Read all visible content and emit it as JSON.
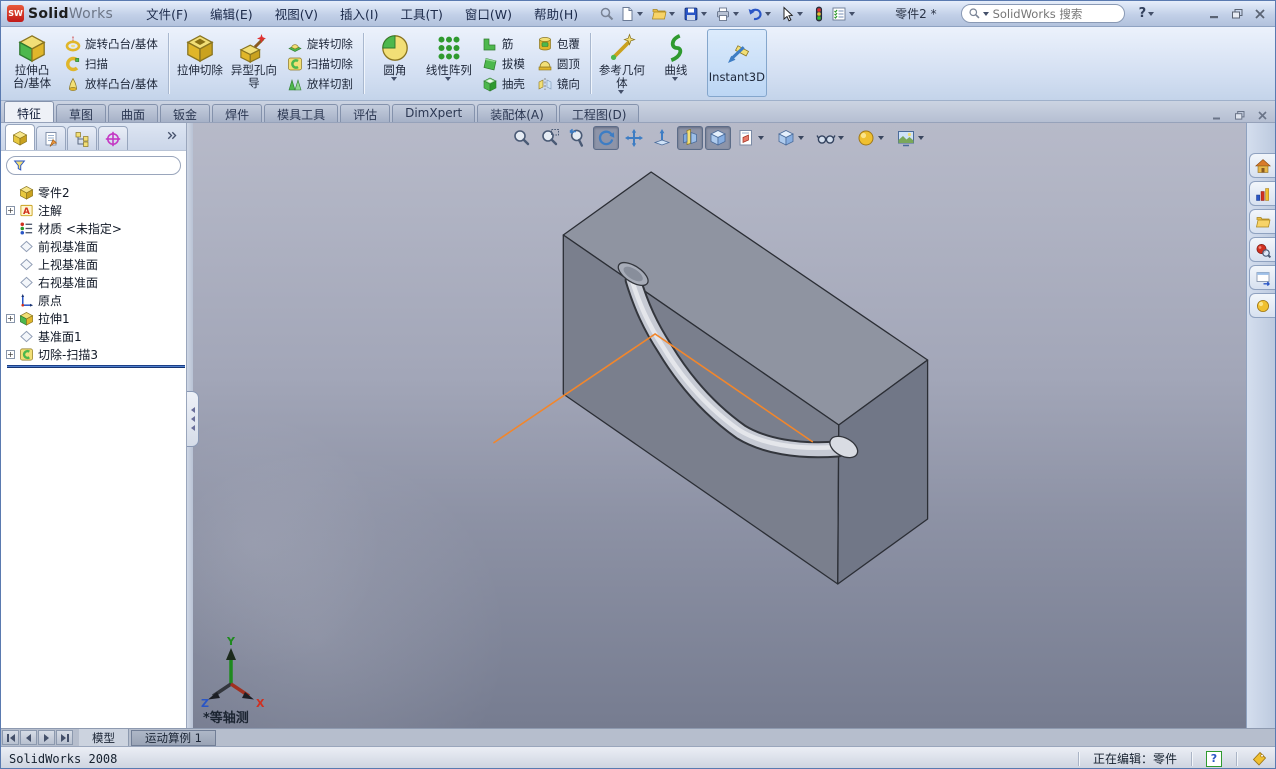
{
  "colors": {
    "brand_red": "#c01818",
    "selection_pressed": "#52607a",
    "sketch_orange": "#f2862b",
    "rollback_blue": "#2c5eb8",
    "viewport_top": "#b7bac9",
    "viewport_bottom": "#767c90",
    "model_front_face": "#7a7f8d",
    "model_top_face": "#8f94a1",
    "model_right_face": "#717787",
    "triad_x_red": "#d03020",
    "triad_y_green": "#1e8a1e",
    "triad_z_blue": "#2a56c6"
  },
  "titlebar": {
    "logo_sw": "SW",
    "logo_solid": "Solid",
    "logo_works": "Works",
    "menus": [
      "文件(F)",
      "编辑(E)",
      "视图(V)",
      "插入(I)",
      "工具(T)",
      "窗口(W)",
      "帮助(H)"
    ],
    "doc_title": "零件2 *",
    "search_placeholder": "SolidWorks 搜索",
    "help_label": "?"
  },
  "commandbar": {
    "extrude_boss": "拉伸凸台/基体",
    "revolve_boss": "旋转凸台/基体",
    "sweep": "扫描",
    "loft_boss": "放样凸台/基体",
    "extrude_cut": "拉伸切除",
    "hole_wizard": "异型孔向导",
    "revolve_cut": "旋转切除",
    "sweep_cut": "扫描切除",
    "loft_cut": "放样切割",
    "fillet": "圆角",
    "linear_pattern": "线性阵列",
    "rib": "筋",
    "draft": "拔模",
    "shell": "抽壳",
    "wrap": "包覆",
    "dome": "圆顶",
    "mirror": "镜向",
    "reference_geometry": "参考几何体",
    "curves": "曲线",
    "instant3d": "Instant3D"
  },
  "ribbon_tabs": {
    "items": [
      "特征",
      "草图",
      "曲面",
      "钣金",
      "焊件",
      "模具工具",
      "评估",
      "DimXpert",
      "装配体(A)",
      "工程图(D)"
    ],
    "active": "特征"
  },
  "feature_tree": {
    "root": "零件2",
    "items": [
      {
        "label": "注解",
        "expandable": true
      },
      {
        "label": "材质 <未指定>",
        "expandable": false
      },
      {
        "label": "前视基准面",
        "expandable": false
      },
      {
        "label": "上视基准面",
        "expandable": false
      },
      {
        "label": "右视基准面",
        "expandable": false
      },
      {
        "label": "原点",
        "expandable": false
      },
      {
        "label": "拉伸1",
        "expandable": true
      },
      {
        "label": "基准面1",
        "expandable": false
      },
      {
        "label": "切除-扫描3",
        "expandable": true
      }
    ]
  },
  "viewport": {
    "view_label": "*等轴测",
    "axis_x": "X",
    "axis_y": "Y",
    "axis_z": "Z"
  },
  "doc_tabs": {
    "model": "模型",
    "motion_study": "运动算例 1"
  },
  "statusbar": {
    "app_version": "SolidWorks 2008",
    "editing_status": "正在编辑：零件",
    "help_glyph": "?"
  }
}
